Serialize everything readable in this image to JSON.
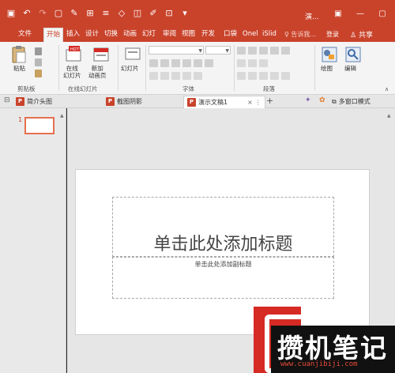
{
  "window": {
    "doc_title": "演...",
    "controls": [
      "▣",
      "—",
      "▢"
    ]
  },
  "quick_access": [
    "save-icon",
    "undo-icon",
    "redo-icon",
    "new-icon",
    "format-painter-icon",
    "customize-icon"
  ],
  "ribbon_tabs": [
    {
      "label": "文件",
      "active": false
    },
    {
      "label": "开始",
      "active": true
    },
    {
      "label": "插入",
      "active": false
    },
    {
      "label": "设计",
      "active": false
    },
    {
      "label": "切换",
      "active": false
    },
    {
      "label": "动画",
      "active": false
    },
    {
      "label": "幻灯",
      "active": false
    },
    {
      "label": "审阅",
      "active": false
    },
    {
      "label": "视图",
      "active": false
    },
    {
      "label": "开发",
      "active": false
    },
    {
      "label": "口袋",
      "active": false
    },
    {
      "label": "Onel",
      "active": false
    },
    {
      "label": "iSlid",
      "active": false
    }
  ],
  "tell_me": "告诉我...",
  "login": "登录",
  "share": "共享",
  "ribbon": {
    "paste_label": "粘贴",
    "clipboard_group": "剪贴板",
    "online_slides_label": "在线\n幻灯片",
    "new_slide_label": "新加\n动画页",
    "online_slides_group": "在线幻灯片",
    "slides_label": "幻灯片",
    "font_group": "字体",
    "paragraph_group": "段落",
    "drawing_label": "绘图",
    "editing_label": "编辑"
  },
  "doc_tabs": [
    {
      "label": "简介头图",
      "active": false
    },
    {
      "label": "截图阴影",
      "active": false
    },
    {
      "label": "演示文稿1",
      "active": true
    }
  ],
  "doc_tabs_right": {
    "multi_window": "多窗口模式"
  },
  "thumbnails": {
    "slide_number": "1"
  },
  "slide": {
    "title_placeholder": "单击此处添加标题",
    "subtitle_placeholder": "单击此处添加副标题"
  },
  "watermark": {
    "text": "攒机笔记",
    "url": "www.cuanjibiji.com"
  },
  "colors": {
    "accent": "#c9432b",
    "ribbon_bg": "#f4f4f4",
    "workspace": "#e6e6e6"
  }
}
